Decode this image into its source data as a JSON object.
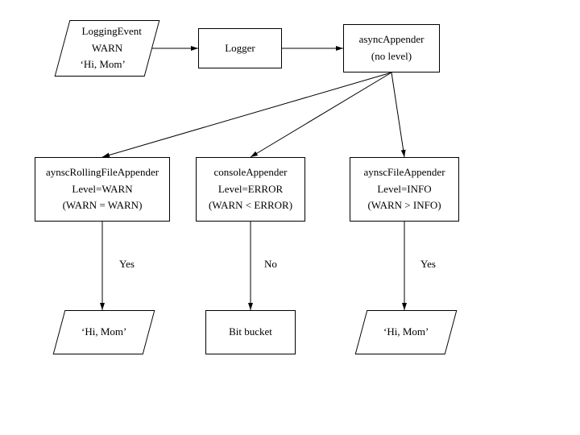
{
  "nodes": {
    "logging_event": {
      "l1": "LoggingEvent",
      "l2": "WARN",
      "l3": "‘Hi, Mom’"
    },
    "logger": {
      "l1": "Logger"
    },
    "async": {
      "l1": "asyncAppender",
      "l2": "(no level)"
    },
    "rolling": {
      "l1": "aynscRollingFileAppender",
      "l2": "Level=WARN",
      "l3": "(WARN = WARN)"
    },
    "console": {
      "l1": "consoleAppender",
      "l2": "Level=ERROR",
      "l3": "(WARN < ERROR)"
    },
    "file": {
      "l1": "aynscFileAppender",
      "l2": "Level=INFO",
      "l3": "(WARN > INFO)"
    },
    "out1": {
      "l1": "‘Hi, Mom’"
    },
    "out2": {
      "l1": "Bit bucket"
    },
    "out3": {
      "l1": "‘Hi, Mom’"
    }
  },
  "labels": {
    "yes1": "Yes",
    "no": "No",
    "yes2": "Yes"
  },
  "chart_data": {
    "type": "diagram",
    "flow": [
      {
        "from": "LoggingEvent(WARN,'Hi, Mom')",
        "to": "Logger"
      },
      {
        "from": "Logger",
        "to": "asyncAppender (no level)"
      },
      {
        "from": "asyncAppender",
        "to": "aynscRollingFileAppender Level=WARN (WARN = WARN)"
      },
      {
        "from": "asyncAppender",
        "to": "consoleAppender Level=ERROR (WARN < ERROR)"
      },
      {
        "from": "asyncAppender",
        "to": "aynscFileAppender Level=INFO (WARN > INFO)"
      },
      {
        "from": "aynscRollingFileAppender",
        "decision": "Yes",
        "to": "'Hi, Mom'"
      },
      {
        "from": "consoleAppender",
        "decision": "No",
        "to": "Bit bucket"
      },
      {
        "from": "aynscFileAppender",
        "decision": "Yes",
        "to": "'Hi, Mom'"
      }
    ]
  }
}
